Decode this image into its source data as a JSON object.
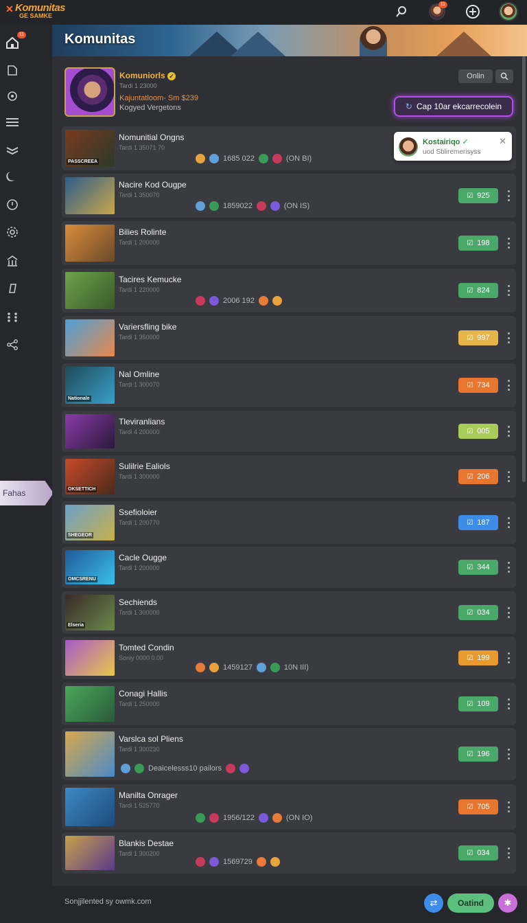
{
  "app": {
    "logo_main": "Komunitas",
    "logo_sub": "GE SAMKE",
    "page_title": "Komunitas",
    "notif_count": "11",
    "side_badge": "11",
    "side_tab_label": "Fahas"
  },
  "header": {
    "name": "Komuniorls",
    "sub": "Tardi 1 23000",
    "line1": "Kajuntatloom- Sm $239",
    "line2": "Kogyed Vergetons",
    "online_button": "Onlin",
    "cta_label": "Cap 10ar ekcarrecolein"
  },
  "notification": {
    "title": "Kostairiqo",
    "subtitle": "uod Sbliremerisyss",
    "close": "✕"
  },
  "rows": [
    {
      "title": "Nomunitial Ongns",
      "sub": "Tardi 1 35071 70",
      "stats": "1685 022",
      "extra": "(ON BI)",
      "thumb_label": "PASSCREEA",
      "c1": "#7a3b1f",
      "c2": "#2b3a2a"
    },
    {
      "title": "Nacire Kod Ougpe",
      "sub": "Tardi 1 350070",
      "stats": "1859022",
      "extra": "(ON IS)",
      "pill": "925",
      "pill_color": "#4aa868",
      "c1": "#2d5c8a",
      "c2": "#c9a74a"
    },
    {
      "title": "Bilies Rolinte",
      "sub": "Tardi 1 200000",
      "pill": "198",
      "pill_color": "#4aa868",
      "c1": "#d98c3a",
      "c2": "#6b4a2a"
    },
    {
      "title": "Tacires Kemucke",
      "sub": "Tardi 1 220000",
      "stats": "2006 192",
      "pill": "824",
      "pill_color": "#4aa868",
      "c1": "#6da34a",
      "c2": "#3a5a2a"
    },
    {
      "title": "Variersfling bike",
      "sub": "Tardi 1 350000",
      "pill": "997",
      "pill_color": "#e8b548",
      "c1": "#4aa0d8",
      "c2": "#e8884a"
    },
    {
      "title": "Nal Omline",
      "sub": "Tardi 1 300070",
      "pill": "734",
      "pill_color": "#e8762f",
      "c1": "#1f4a5a",
      "c2": "#3aa0c8",
      "thumb_label": "Nationale"
    },
    {
      "title": "Tleviranlians",
      "sub": "Tardi 4 200000",
      "pill": "005",
      "pill_color": "#a8cc58",
      "c1": "#8a3aa8",
      "c2": "#2a1a3a"
    },
    {
      "title": "Sulilrie Ealiols",
      "sub": "Tardi 1 300000",
      "pill": "206",
      "pill_color": "#e8762f",
      "c1": "#c84a2a",
      "c2": "#4a2a1a",
      "thumb_label": "OKSETTICH"
    },
    {
      "title": "Ssefioloier",
      "sub": "Tardi 1 200770",
      "pill": "187",
      "pill_color": "#3d8de8",
      "c1": "#6aa0c8",
      "c2": "#c8b04a",
      "thumb_label": "SHEGEOR"
    },
    {
      "title": "Cacle Ougge",
      "sub": "Tardi 1 200000",
      "pill": "344",
      "pill_color": "#4aa868",
      "c1": "#1f5a9a",
      "c2": "#3ac0e8",
      "thumb_label": "OMCSRENU"
    },
    {
      "title": "Sechiends",
      "sub": "Tardi 1 300000",
      "pill": "034",
      "pill_color": "#4aa868",
      "c1": "#3a2a2a",
      "c2": "#6a8a4a",
      "thumb_label": "Elseria"
    },
    {
      "title": "Tomted Condin",
      "sub": "Soniy 0000 0.00",
      "stats": "1459127",
      "extra": "10N III)",
      "pill": "199",
      "pill_color": "#e89a2f",
      "c1": "#a858c8",
      "c2": "#e8c84a"
    },
    {
      "title": "Conagi Hallis",
      "sub": "Tardi 1 250000",
      "pill": "109",
      "pill_color": "#4aa868",
      "c1": "#4aa85a",
      "c2": "#2a5a3a"
    },
    {
      "title": "Varslca sol Pliens",
      "sub": "Tardi 1 300230",
      "stats": "Deaicelesss10 pailors",
      "pill": "196",
      "pill_color": "#4aa868",
      "c1": "#d8a84a",
      "c2": "#4a8ac8"
    },
    {
      "title": "Manilta Onrager",
      "sub": "Tardi 1 525770",
      "stats": "1956/122",
      "extra": "(ON IO)",
      "pill": "705",
      "pill_color": "#e8762f",
      "c1": "#3a8ac8",
      "c2": "#1f4a7a"
    },
    {
      "title": "Blankis Destae",
      "sub": "Tardi 1 300200",
      "stats": "1569729",
      "pill": "034",
      "pill_color": "#4aa868",
      "c1": "#c8a04a",
      "c2": "#5a3a8a"
    }
  ],
  "footer": {
    "text": "Sonjjilented sy owmk.com",
    "button": "Oatind"
  },
  "icons": [
    "search-icon",
    "avatar",
    "plus-circle-icon",
    "home-icon",
    "bookmark-icon",
    "shield-icon",
    "menu-icon",
    "layers-icon",
    "moon-icon",
    "compass-icon",
    "gear-icon",
    "library-icon",
    "music-icon",
    "grid-icon",
    "share-icon",
    "kebab-icon",
    "check-icon"
  ]
}
